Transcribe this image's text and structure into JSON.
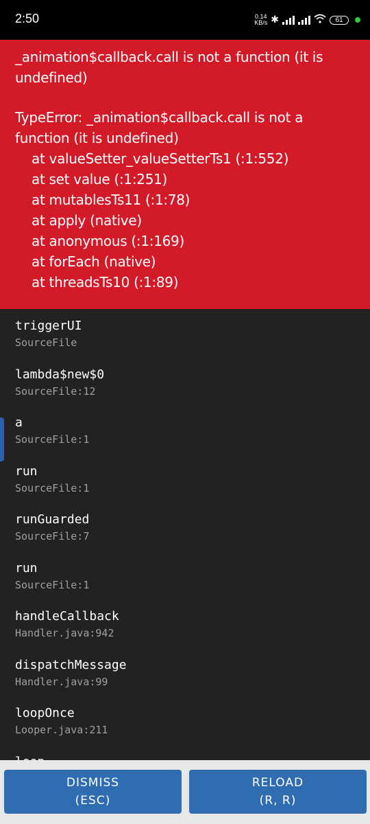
{
  "status_bar": {
    "time": "2:50",
    "net_speed_value": "0.14",
    "net_speed_unit": "KB/s",
    "battery": "61",
    "icons": [
      "bluetooth-icon",
      "signal-icon",
      "signal-icon",
      "wifi-icon",
      "battery-icon"
    ]
  },
  "error": {
    "message": "_animation$callback.call is not a function (it is undefined)",
    "type_line": "TypeError: _animation$callback.call is not a function (it is undefined)",
    "stack": [
      "at valueSetter_valueSetterTs1 (:1:552)",
      "at set value (:1:251)",
      "at mutablesTs11 (:1:78)",
      "at apply (native)",
      "at anonymous (:1:169)",
      "at forEach (native)",
      "at threadsTs10 (:1:89)"
    ]
  },
  "frames": [
    {
      "name": "triggerUI",
      "file": "SourceFile"
    },
    {
      "name": "lambda$new$0",
      "file": "SourceFile:12"
    },
    {
      "name": "a",
      "file": "SourceFile:1"
    },
    {
      "name": "run",
      "file": "SourceFile:1"
    },
    {
      "name": "runGuarded",
      "file": "SourceFile:7"
    },
    {
      "name": "run",
      "file": "SourceFile:1"
    },
    {
      "name": "handleCallback",
      "file": "Handler.java:942"
    },
    {
      "name": "dispatchMessage",
      "file": "Handler.java:99"
    },
    {
      "name": "loopOnce",
      "file": "Looper.java:211"
    },
    {
      "name": "loop",
      "file": ""
    }
  ],
  "buttons": {
    "dismiss_label": "DISMISS",
    "dismiss_shortcut": "(ESC)",
    "reload_label": "RELOAD",
    "reload_shortcut": "(R, R)"
  },
  "colors": {
    "error_bg": "#d21a28",
    "list_bg": "#222222",
    "button_bg": "#2f6db0"
  }
}
